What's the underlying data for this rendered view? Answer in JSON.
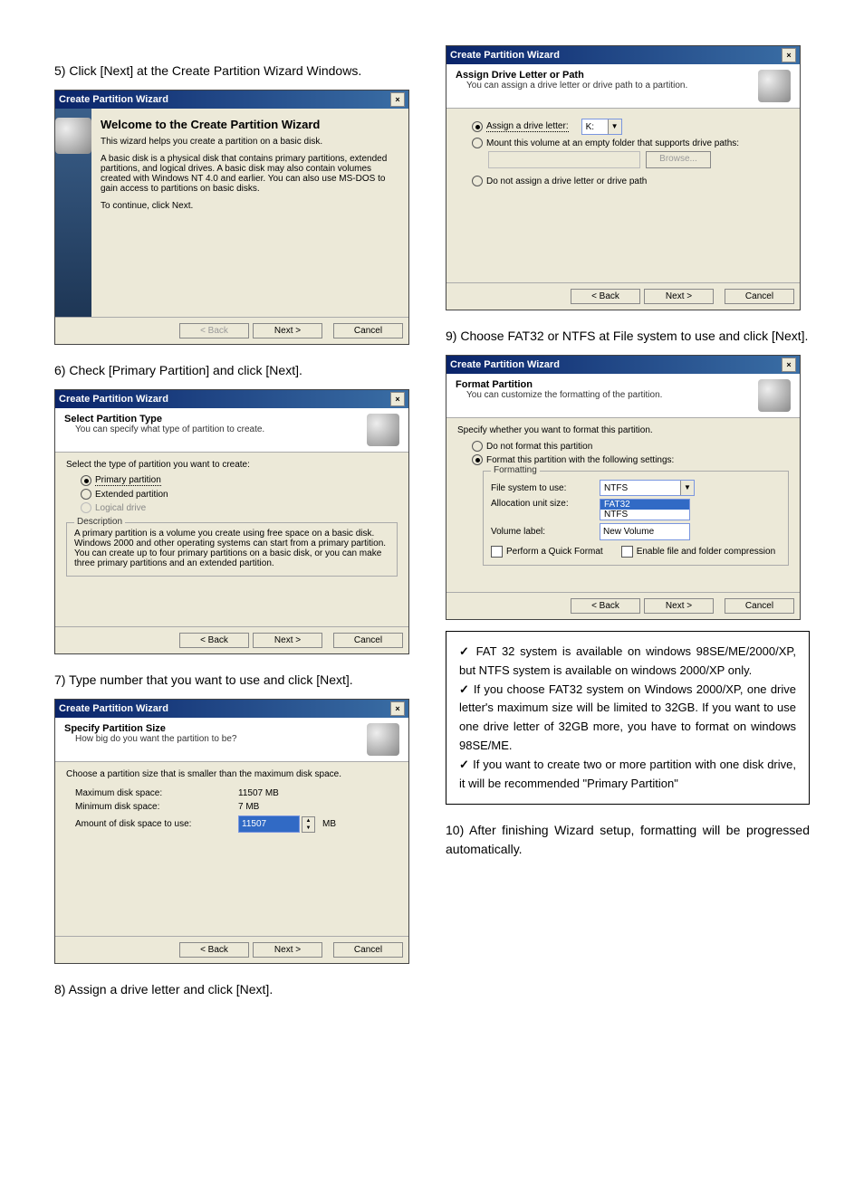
{
  "steps": {
    "s5": "5) Click [Next] at the Create Partition Wizard Windows.",
    "s6": "6) Check [Primary Partition] and click [Next].",
    "s7": "7) Type number that you want to use and click [Next].",
    "s8": "8) Assign a drive letter and click [Next].",
    "s9": "9) Choose FAT32 or NTFS at File system to use and click [Next].",
    "s10": "10) After finishing Wizard setup, formatting will be progressed automatically."
  },
  "common": {
    "title": "Create Partition Wizard",
    "back": "< Back",
    "next": "Next >",
    "cancel": "Cancel"
  },
  "w1": {
    "heading": "Welcome to the Create Partition Wizard",
    "line1": "This wizard helps you create a partition on a basic disk.",
    "line2": "A basic disk is a physical disk that contains primary partitions, extended partitions, and logical drives. A basic disk may also contain volumes created with Windows NT 4.0 and earlier. You can also use MS-DOS to gain access to partitions on basic disks.",
    "line3": "To continue, click Next."
  },
  "w2": {
    "ht": "Select Partition Type",
    "hs": "You can specify what type of partition to create.",
    "prompt": "Select the type of partition you want to create:",
    "opt1": "Primary partition",
    "opt2": "Extended partition",
    "opt3": "Logical drive",
    "descLabel": "Description",
    "desc": "A primary partition is a volume you create using free space on a basic disk. Windows 2000 and other operating systems can start from a primary partition. You can create up to four primary partitions on a basic disk, or you can make three primary partitions and an extended partition."
  },
  "w3": {
    "ht": "Specify Partition Size",
    "hs": "How big do you want the partition to be?",
    "prompt": "Choose a partition size that is smaller than the maximum disk space.",
    "l1": "Maximum disk space:",
    "v1": "11507 MB",
    "l2": "Minimum disk space:",
    "v2": "7 MB",
    "l3": "Amount of disk space to use:",
    "v3": "11507",
    "mb": "MB"
  },
  "w4": {
    "ht": "Assign Drive Letter or Path",
    "hs": "You can assign a drive letter or drive path to a partition.",
    "opt1": "Assign a drive letter:",
    "letter": "K:",
    "opt2": "Mount this volume at an empty folder that supports drive paths:",
    "browse": "Browse...",
    "opt3": "Do not assign a drive letter or drive path"
  },
  "w5": {
    "ht": "Format Partition",
    "hs": "You can customize the formatting of the partition.",
    "prompt": "Specify whether you want to format this partition.",
    "opt1": "Do not format this partition",
    "opt2": "Format this partition with the following settings:",
    "grp": "Formatting",
    "l1": "File system to use:",
    "v1": "NTFS",
    "dd1": "FAT32",
    "dd2": "NTFS",
    "l2": "Allocation unit size:",
    "l3": "Volume label:",
    "v3": "New Volume",
    "c1": "Perform a Quick Format",
    "c2": "Enable file and folder compression"
  },
  "notes": {
    "n1": "FAT 32 system is available on windows 98SE/ME/2000/XP, but NTFS system is available on windows 2000/XP only.",
    "n2": "If you choose FAT32 system on Windows 2000/XP, one drive letter's maximum size will be limited to 32GB. If you want to use one drive letter of 32GB more, you have to format on windows 98SE/ME.",
    "n3": "If you want to create two or more partition with one disk drive, it will be recommended \"Primary Partition\""
  }
}
